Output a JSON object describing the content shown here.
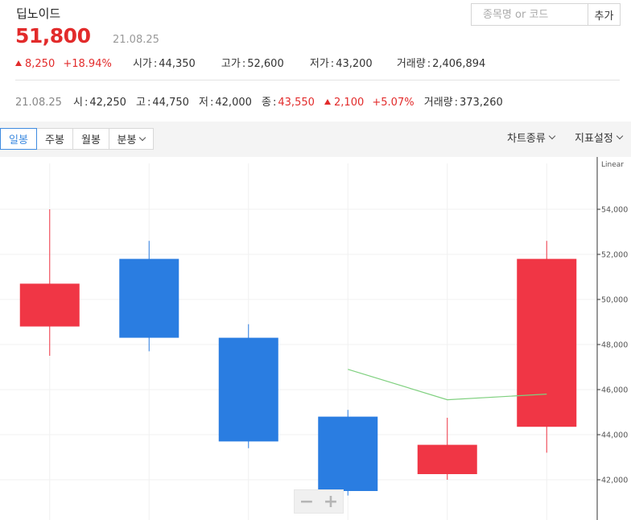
{
  "stock": {
    "name": "딥노이드",
    "price": "51,800",
    "date": "21.08.25"
  },
  "search": {
    "placeholder": "종목명 or 코드",
    "add_label": "추가"
  },
  "stats": {
    "change": "8,250",
    "change_pct": "+18.94%",
    "open_label": "시가",
    "open": "44,350",
    "high_label": "고가",
    "high": "52,600",
    "low_label": "저가",
    "low": "43,200",
    "volume_label": "거래량",
    "volume": "2,406,894"
  },
  "daily": {
    "date": "21.08.25",
    "open_label": "시",
    "open": "42,250",
    "high_label": "고",
    "high": "44,750",
    "low_label": "저",
    "low": "42,000",
    "close_label": "종",
    "close": "43,550",
    "change": "2,100",
    "change_pct": "+5.07%",
    "volume_label": "거래량",
    "volume": "373,260"
  },
  "toolbar": {
    "tabs": [
      "일봉",
      "주봉",
      "월봉",
      "분봉"
    ],
    "active_tab": "일봉",
    "chart_type_label": "차트종류",
    "indicator_label": "지표설정"
  },
  "colors": {
    "up": "#f03645",
    "down": "#2a7de1",
    "ma": "#7fd07f",
    "accent": "#e22b2b"
  },
  "chart_data": {
    "type": "candlestick",
    "scale": "Linear",
    "ylim": [
      40600,
      55000
    ],
    "yticks": [
      42000,
      44000,
      46000,
      48000,
      50000,
      52000,
      54000
    ],
    "ytick_labels": [
      "42,000",
      "44,000",
      "46,000",
      "48,000",
      "50,000",
      "52,000",
      "54,000"
    ],
    "candles": [
      {
        "open": 48800,
        "close": 50700,
        "high": 54000,
        "low": 47500
      },
      {
        "open": 51800,
        "close": 48300,
        "high": 52600,
        "low": 47700
      },
      {
        "open": 48300,
        "close": 43700,
        "high": 48900,
        "low": 43400
      },
      {
        "open": 44800,
        "close": 41500,
        "high": 45100,
        "low": 41300
      },
      {
        "open": 42250,
        "close": 43550,
        "high": 44750,
        "low": 42000
      },
      {
        "open": 44350,
        "close": 51800,
        "high": 52600,
        "low": 43200
      }
    ],
    "moving_average": [
      null,
      null,
      null,
      46900,
      45550,
      45800
    ]
  }
}
